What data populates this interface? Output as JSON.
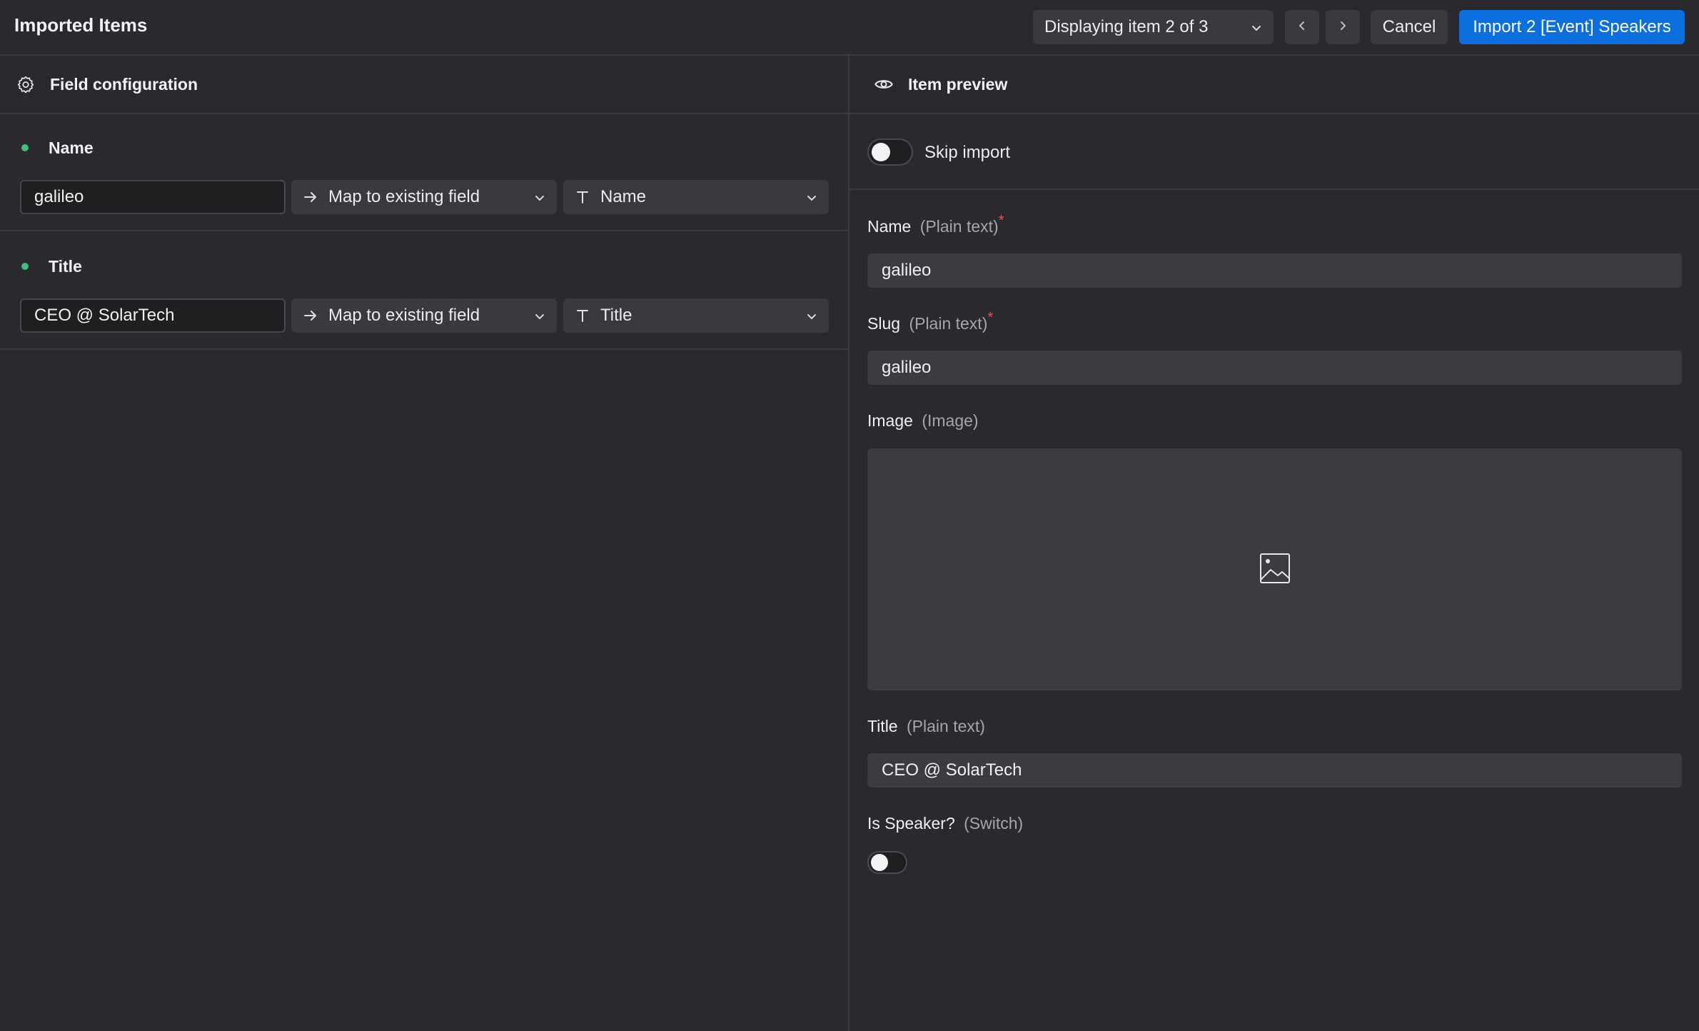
{
  "header": {
    "title": "Imported Items",
    "item_selector": "Displaying item 2 of 3",
    "cancel_label": "Cancel",
    "import_label": "Import 2 [Event] Speakers"
  },
  "left_panel": {
    "title": "Field configuration",
    "fields": [
      {
        "name": "Name",
        "source_value": "galileo",
        "mapping": "Map to existing field",
        "target": "Name"
      },
      {
        "name": "Title",
        "source_value": "CEO @ SolarTech",
        "mapping": "Map to existing field",
        "target": "Title"
      }
    ]
  },
  "right_panel": {
    "title": "Item preview",
    "skip_label": "Skip import",
    "fields": [
      {
        "label": "Name",
        "type": "(Plain text)",
        "required": "*",
        "value": "galileo"
      },
      {
        "label": "Slug",
        "type": "(Plain text)",
        "required": "*",
        "value": "galileo"
      },
      {
        "label": "Image",
        "type": "(Image)"
      },
      {
        "label": "Title",
        "type": "(Plain text)",
        "value": "CEO @ SolarTech"
      },
      {
        "label": "Is Speaker?",
        "type": "(Switch)"
      }
    ]
  },
  "colors": {
    "background": "#2a292d",
    "accent": "#0b6fe0",
    "status_dot": "#3fbf7f",
    "required": "#ff4d4d"
  },
  "icons": {
    "field_config": "gear-icon",
    "preview": "eye-icon",
    "mapping": "arrow-right-icon",
    "target_type": "text-type-icon",
    "image_placeholder": "image-icon"
  }
}
